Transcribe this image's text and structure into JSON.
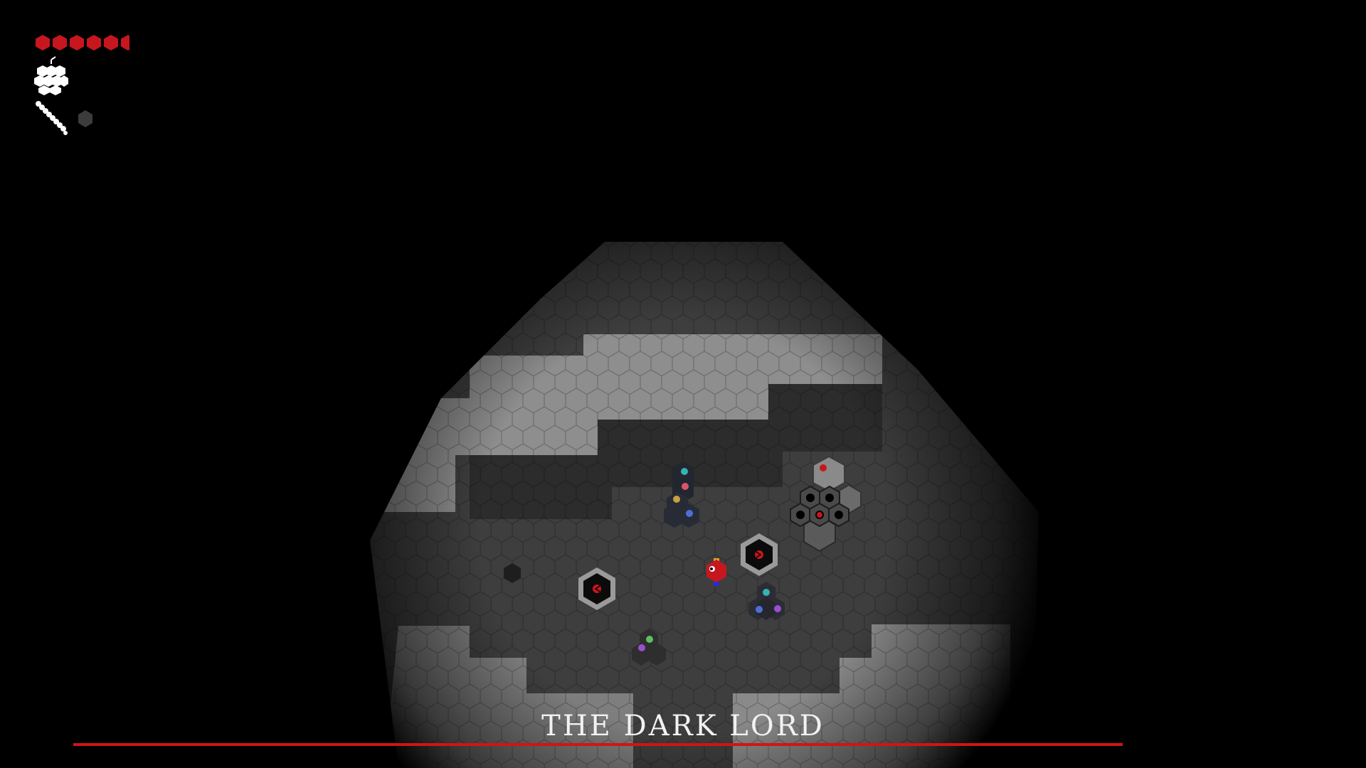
{
  "hud": {
    "health": {
      "max": 6,
      "current": 5.6
    },
    "relic_icon": "bomb-cluster-icon",
    "weapon_icon": "bead-staff-icon",
    "ammo_icon": "hex-orb-icon",
    "colors": {
      "health": "#c8161e",
      "icon": "#ffffff",
      "ammo": "#3c3c3c"
    }
  },
  "boss": {
    "name": "THE DARK LORD",
    "health_fraction": 1.0,
    "bar_color": "#d21414"
  },
  "gems": {
    "cyan": "#33b3b3",
    "pink": "#d9556a",
    "gold": "#c8a040",
    "blue": "#4f6fd8",
    "purple": "#9a4fd0",
    "green": "#5fbf5f",
    "red": "#c8161e"
  }
}
